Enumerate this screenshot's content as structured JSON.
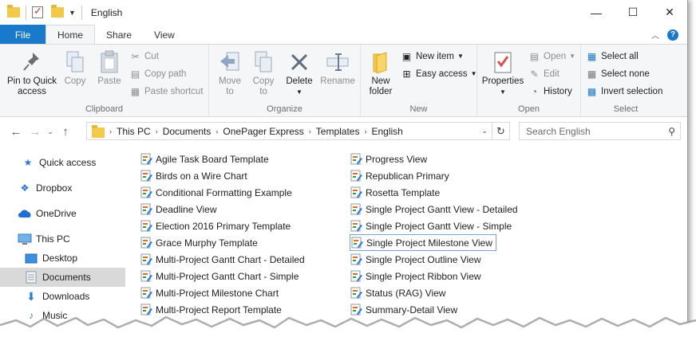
{
  "window": {
    "title": "English"
  },
  "titlebar": {
    "minimize": "—",
    "maximize": "☐",
    "close": "✕"
  },
  "tabs": [
    {
      "label": "File",
      "type": "file"
    },
    {
      "label": "Home",
      "type": "active"
    },
    {
      "label": "Share",
      "type": "normal"
    },
    {
      "label": "View",
      "type": "normal"
    }
  ],
  "ribbon": {
    "clipboard": {
      "label": "Clipboard",
      "pin": "Pin to Quick\naccess",
      "copy": "Copy",
      "paste": "Paste",
      "cut": "Cut",
      "copy_path": "Copy path",
      "paste_shortcut": "Paste shortcut"
    },
    "organize": {
      "label": "Organize",
      "move_to": "Move\nto",
      "copy_to": "Copy\nto",
      "delete": "Delete",
      "rename": "Rename"
    },
    "new": {
      "label": "New",
      "new_folder": "New\nfolder",
      "new_item": "New item",
      "easy_access": "Easy access"
    },
    "open": {
      "label": "Open",
      "properties": "Properties",
      "open": "Open",
      "edit": "Edit",
      "history": "History"
    },
    "select": {
      "label": "Select",
      "select_all": "Select all",
      "select_none": "Select none",
      "invert": "Invert selection"
    }
  },
  "address": {
    "crumbs": [
      "This PC",
      "Documents",
      "OnePager Express",
      "Templates",
      "English"
    ],
    "search_placeholder": "Search English"
  },
  "nav": [
    {
      "label": "Quick access",
      "icon": "star-icon"
    },
    {
      "label": "Dropbox",
      "icon": "dropbox-icon"
    },
    {
      "label": "OneDrive",
      "icon": "cloud-icon"
    },
    {
      "label": "This PC",
      "icon": "computer-icon"
    },
    {
      "label": "Desktop",
      "icon": "desktop-icon"
    },
    {
      "label": "Documents",
      "icon": "documents-icon",
      "selected": true
    },
    {
      "label": "Downloads",
      "icon": "download-icon"
    },
    {
      "label": "Music",
      "icon": "music-icon"
    }
  ],
  "files": {
    "col1": [
      "Agile Task Board Template",
      "Birds on a Wire Chart",
      "Conditional Formatting Example",
      "Deadline View",
      "Election 2016 Primary Template",
      "Grace Murphy Template",
      "Multi-Project Gantt Chart - Detailed",
      "Multi-Project Gantt Chart - Simple",
      "Multi-Project Milestone Chart",
      "Multi-Project Report Template"
    ],
    "col2": [
      "Progress View",
      "Republican Primary",
      "Rosetta Template",
      "Single Project Gantt View - Detailed",
      "Single Project Gantt View - Simple",
      "Single Project Milestone View",
      "Single Project Outline View",
      "Single Project Ribbon View",
      "Status (RAG) View",
      "Summary-Detail View"
    ],
    "focused": "Single Project Milestone View"
  },
  "colors": {
    "file_tab": "#1979ca",
    "accent": "#1979ca",
    "folder": "#f3c94a"
  }
}
